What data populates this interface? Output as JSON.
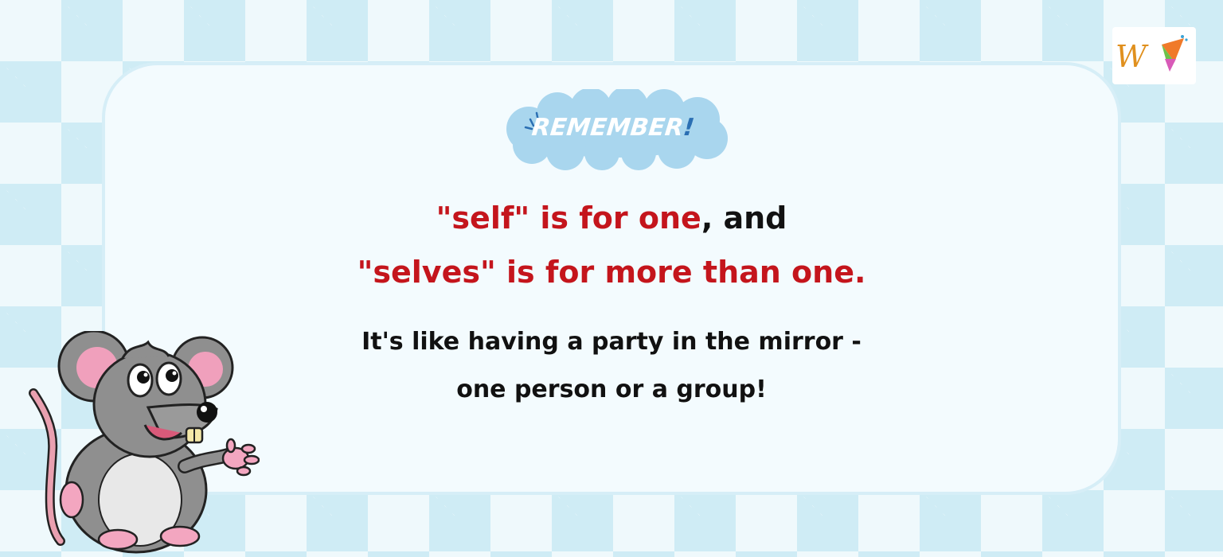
{
  "banner": {
    "title": "REMEMBER",
    "exclaim": "!"
  },
  "rule": {
    "line1_red": "\"self\" is for one",
    "line1_black": ", and",
    "line2_red": "\"selves\" is for more than one."
  },
  "explanation": {
    "line1": "It's like having a party in the mirror -",
    "line2": "one person or a group!"
  },
  "logo": {
    "letter": "W"
  },
  "colors": {
    "accent_red": "#c4151c",
    "text_black": "#111111",
    "cloud_blue": "#a9d6ee",
    "check_blue": "#cfecf5"
  }
}
